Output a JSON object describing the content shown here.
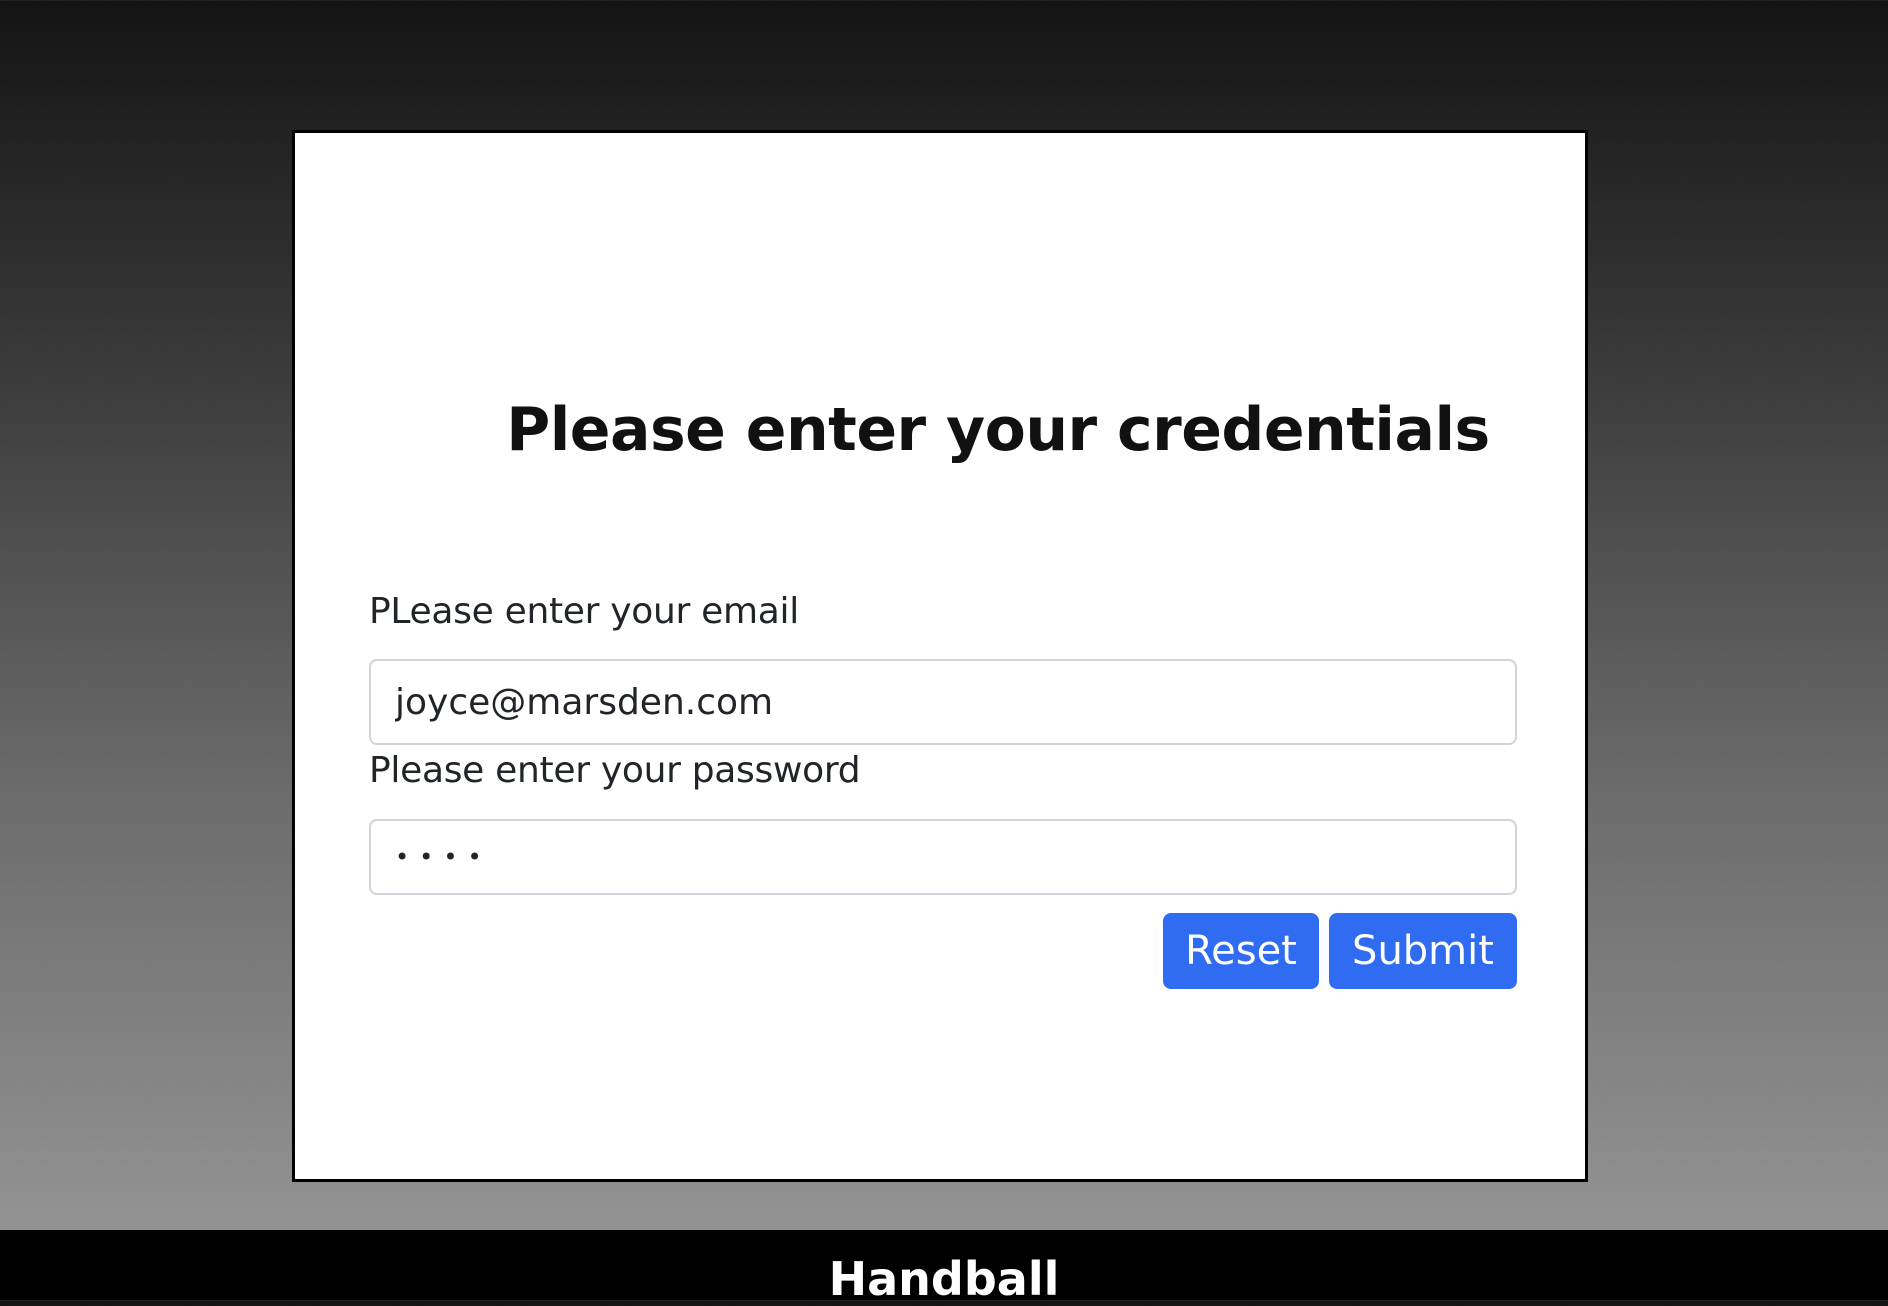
{
  "form": {
    "title": "Please enter your credentials",
    "email_label": "PLease enter your email",
    "email_value": "joyce@marsden.com",
    "password_label": "Please enter your password",
    "password_value": "1234",
    "reset_label": "Reset",
    "submit_label": "Submit"
  },
  "footer": {
    "text": "Handball"
  },
  "colors": {
    "button": "#2f6cf2",
    "card_border": "#000000",
    "footer_bg": "#000000"
  }
}
